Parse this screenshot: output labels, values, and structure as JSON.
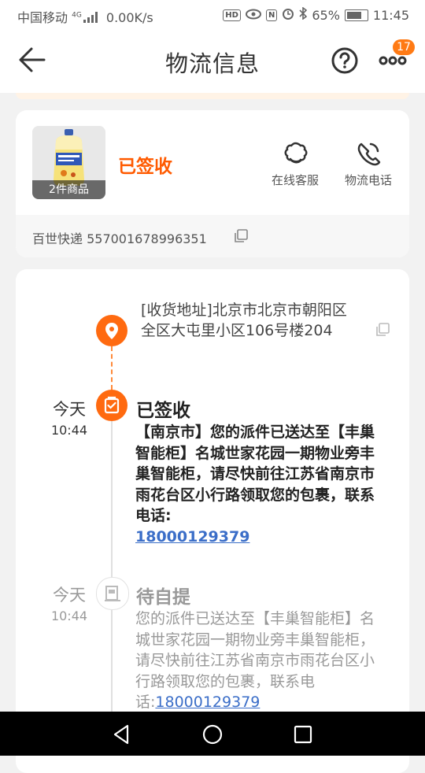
{
  "status_bar": {
    "carrier": "中国移动",
    "network": "4G",
    "speed": "0.00K/s",
    "hd": "HD",
    "nfc": "N",
    "battery": "65%",
    "time": "11:45"
  },
  "header": {
    "title": "物流信息",
    "badge_count": "17"
  },
  "order": {
    "thumb_label": "2件商品",
    "status": "已签收",
    "actions": [
      {
        "label": "在线客服",
        "icon": "customer-service-icon"
      },
      {
        "label": "物流电话",
        "icon": "phone-icon"
      }
    ],
    "express": "百世快递 557001678996351"
  },
  "timeline": {
    "address": "[收货地址]北京市北京市朝阳区全区大屯里小区106号楼204",
    "events": [
      {
        "day": "今天",
        "time": "10:44",
        "title": "已签收",
        "body_text": "【南京市】您的派件已送达至【丰巢智能柜】名城世家花园一期物业旁丰巢智能柜，请尽快前往江苏省南京市雨花台区小行路领取您的包裹，联系电话:",
        "phone": "18000129379"
      },
      {
        "day": "今天",
        "time": "10:44",
        "title": "待自提",
        "body_text": "您的派件已送达至【丰巢智能柜】名城世家花园一期物业旁丰巢智能柜，请尽快前往江苏省南京市雨花台区小行路领取您的包裹，联系电话:",
        "phone": "18000129379"
      }
    ]
  },
  "colors": {
    "accent": "#ff6a10",
    "link": "#3b6ec8"
  }
}
